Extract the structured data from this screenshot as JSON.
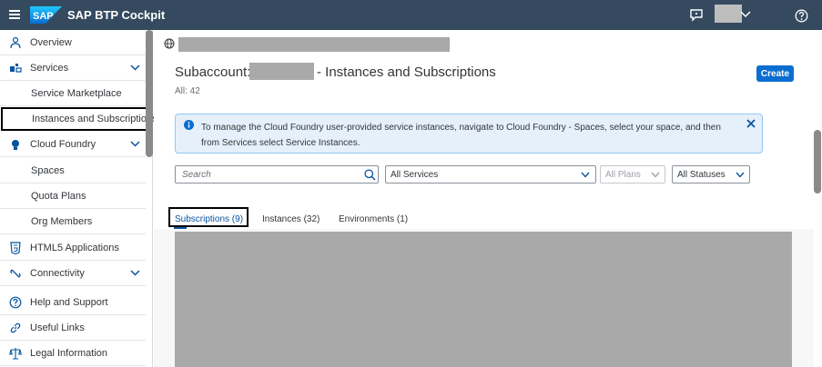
{
  "shellbar": {
    "logo_text": "SAP",
    "title": "SAP BTP Cockpit",
    "icons": {
      "menu": "hamburger-icon",
      "feedback": "feedback-icon",
      "user": "user-avatar",
      "help": "help-icon"
    }
  },
  "sidenav": {
    "items": [
      {
        "label": "Overview",
        "icon": "overview-icon"
      },
      {
        "label": "Services",
        "icon": "services-icon",
        "expanded": true
      },
      {
        "label": "Service Marketplace"
      },
      {
        "label": "Instances and Subscriptions",
        "selected": true
      },
      {
        "label": "Cloud Foundry",
        "icon": "cloud-foundry-icon",
        "expanded": true
      },
      {
        "label": "Spaces"
      },
      {
        "label": "Quota Plans"
      },
      {
        "label": "Org Members"
      },
      {
        "label": "HTML5 Applications",
        "icon": "html5-icon"
      },
      {
        "label": "Connectivity",
        "icon": "connectivity-icon",
        "expanded": true
      },
      {
        "label": "Help and Support",
        "icon": "help-circle-icon"
      },
      {
        "label": "Useful Links",
        "icon": "link-icon"
      },
      {
        "label": "Legal Information",
        "icon": "legal-icon"
      }
    ]
  },
  "page": {
    "title_prefix": "Subaccount:",
    "title_suffix": "- Instances and Subscriptions",
    "count": "All: 42",
    "create_label": "Create"
  },
  "info": {
    "text": "To manage the Cloud Foundry user-provided service instances, navigate to Cloud Foundry - Spaces, select your space, and then from Services select Service Instances."
  },
  "filters": {
    "search_placeholder": "Search",
    "services_value": "All Services",
    "plans_value": "All Plans",
    "status_value": "All Statuses"
  },
  "tabs": [
    {
      "label": "Subscriptions (9)",
      "active": true
    },
    {
      "label": "Instances (32)"
    },
    {
      "label": "Environments (1)"
    }
  ],
  "colors": {
    "shellbar": "#354a5f",
    "accent": "#0a6ed1",
    "info_bg": "#e5f0fa",
    "mask": "#a9a9a9"
  }
}
